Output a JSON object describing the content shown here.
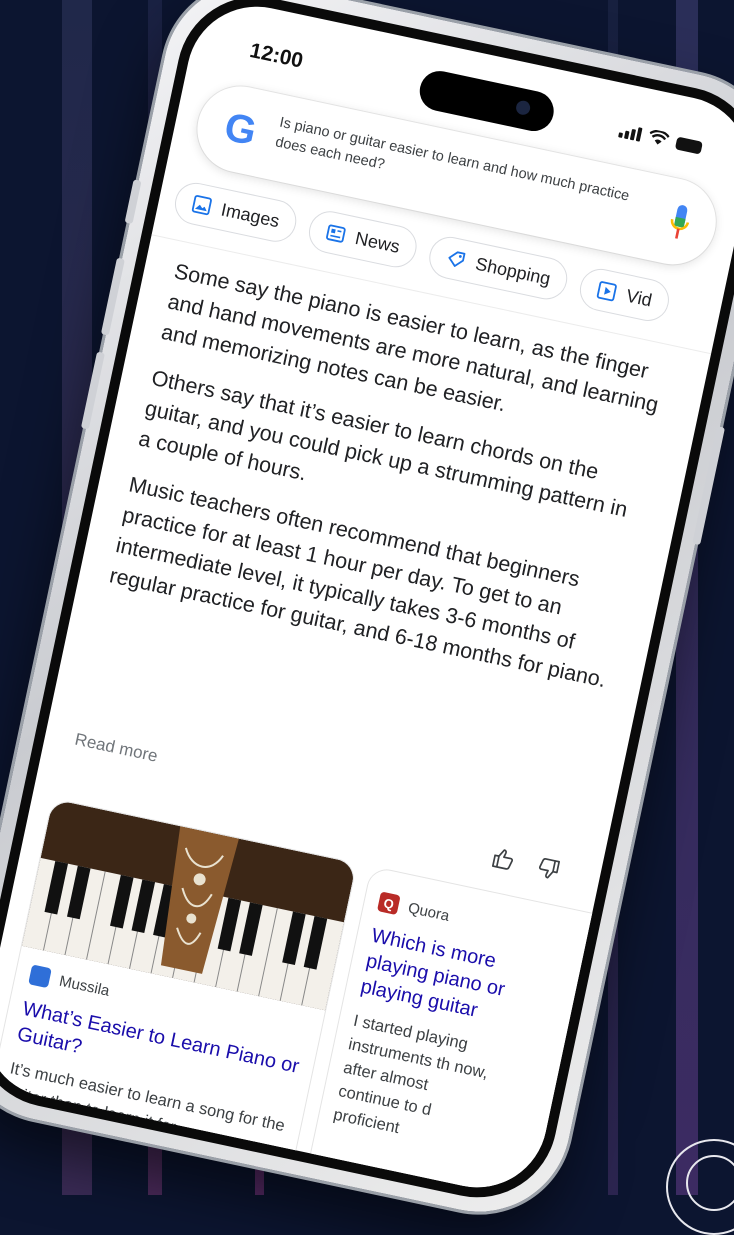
{
  "colors": {
    "background": "#0c1530",
    "link_blue": "#1a0dab",
    "google_blue": "#4285f4",
    "google_red": "#ea4335",
    "google_yellow": "#fbbc05",
    "google_green": "#34a853"
  },
  "status_bar": {
    "time": "12:00",
    "icons": [
      "signal-icon",
      "wifi-icon",
      "battery-icon"
    ]
  },
  "search": {
    "logo_text": "G",
    "query": "Is piano or guitar easier to learn and how much practice does each need?",
    "mic_icon": "mic-icon"
  },
  "chips": [
    {
      "label": "Images",
      "icon": "image-icon"
    },
    {
      "label": "News",
      "icon": "news-icon"
    },
    {
      "label": "Shopping",
      "icon": "tag-icon"
    },
    {
      "label": "Vid",
      "icon": "video-icon"
    }
  ],
  "answer": {
    "paragraphs": [
      "Some say the piano is easier to learn, as the finger and hand movements are more natural, and learning and memorizing notes can be easier.",
      "Others say that it’s easier to learn chords on the guitar, and you could pick up a strumming pattern in a couple of hours.",
      "Music teachers often recommend that beginners practice for at least 1 hour per day. To get to an intermediate level, it typically takes 3-6 months of regular practice for guitar, and 6-18 months for piano."
    ],
    "read_more": "Read more"
  },
  "results": [
    {
      "source": "Mussila",
      "favicon_letter": "",
      "title": "What’s Easier to Learn Piano or Guitar?",
      "snippet": "It’s much easier to learn a song for the guitar than to learn it for"
    },
    {
      "source": "Quora",
      "favicon_letter": "Q",
      "title": "Which is more playing piano or playing guitar",
      "snippet": "I started playing instruments th now, after almost continue to d proficient"
    }
  ]
}
